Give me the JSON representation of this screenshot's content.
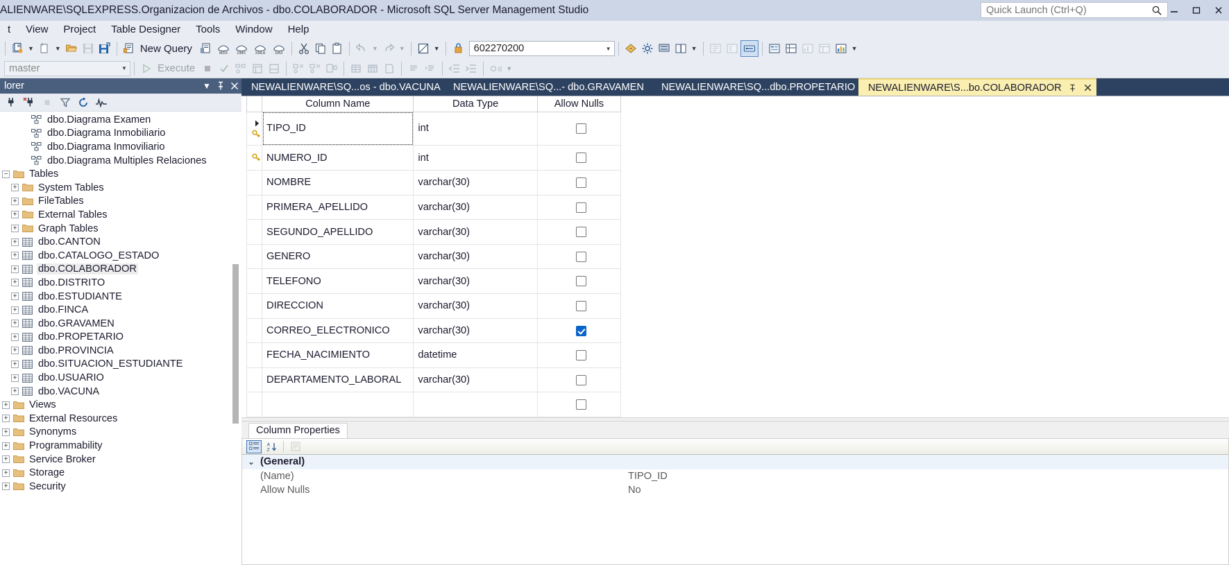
{
  "titlebar": {
    "title": "ALIENWARE\\SQLEXPRESS.Organizacion de Archivos - dbo.COLABORADOR - Microsoft SQL Server Management Studio",
    "quick_launch_placeholder": "Quick Launch (Ctrl+Q)",
    "quick_launch_value": "",
    "search_icon": "search-icon",
    "minimize_label": "—",
    "restore_label": "❐",
    "close_label": "✕"
  },
  "menubar": {
    "items": [
      {
        "label": "t"
      },
      {
        "label": "View"
      },
      {
        "label": "Project"
      },
      {
        "label": "Table Designer"
      },
      {
        "label": "Tools"
      },
      {
        "label": "Window"
      },
      {
        "label": "Help"
      }
    ]
  },
  "toolbar": {
    "new_query_label": "New Query",
    "object_value": "602270200",
    "database_value": "master",
    "execute_label": "Execute",
    "buttons": [
      "new-project-icon",
      "new-item-icon",
      "open-file-icon",
      "save-icon",
      "save-all-icon",
      "new-query-icon",
      "new-query-with-current-connection-icon",
      "new-analysis-services-mdx-query-icon",
      "new-analysis-services-dmx-query-icon",
      "new-analysis-services-xmla-query-icon",
      "new-dax-query-icon",
      "cut-icon",
      "copy-icon",
      "paste-icon",
      "undo-icon",
      "redo-icon",
      "toggle-window-icon",
      "object-explorer-details-icon",
      "properties-window-icon",
      "registered-servers-icon",
      "template-explorer-icon",
      "solution-explorer-icon",
      "bookmark-window-icon",
      "error-list-icon",
      "utility-explorer-icon",
      "object-explorer-icon"
    ],
    "query_buttons": [
      "execute-icon",
      "stop-icon",
      "parse-icon",
      "display-estimated-plan-icon",
      "query-options-icon",
      "include-actual-plan-icon",
      "include-client-statistics-icon",
      "results-to-text-icon",
      "results-to-grid-icon",
      "results-to-file-icon",
      "comment-icon",
      "uncomment-icon",
      "decrease-indent-icon",
      "increase-indent-icon",
      "specify-values-for-template-parameters-icon"
    ]
  },
  "explorer": {
    "title": "lorer",
    "header_buttons": [
      "dropdown-icon",
      "pin-icon",
      "close-icon"
    ],
    "toolbar_buttons": [
      "connect-icon",
      "disconnect-icon",
      "stop-icon",
      "filter-icon",
      "refresh-icon",
      "activity-monitor-icon"
    ],
    "tree": [
      {
        "label": "dbo.Diagrama Examen",
        "indent": 3,
        "expander": "none",
        "icon": "diagram-icon"
      },
      {
        "label": "dbo.Diagrama Inmobiliario",
        "indent": 3,
        "expander": "none",
        "icon": "diagram-icon"
      },
      {
        "label": "dbo.Diagrama Inmoviliario",
        "indent": 3,
        "expander": "none",
        "icon": "diagram-icon"
      },
      {
        "label": "dbo.Diagrama Multiples Relaciones",
        "indent": 3,
        "expander": "none",
        "icon": "diagram-icon"
      },
      {
        "label": "Tables",
        "indent": 1,
        "expander": "minus",
        "icon": "folder-icon"
      },
      {
        "label": "System Tables",
        "indent": 2,
        "expander": "plus",
        "icon": "folder-icon"
      },
      {
        "label": "FileTables",
        "indent": 2,
        "expander": "plus",
        "icon": "folder-icon"
      },
      {
        "label": "External Tables",
        "indent": 2,
        "expander": "plus",
        "icon": "folder-icon"
      },
      {
        "label": "Graph Tables",
        "indent": 2,
        "expander": "plus",
        "icon": "folder-icon"
      },
      {
        "label": "dbo.CANTON",
        "indent": 2,
        "expander": "plus",
        "icon": "table-icon"
      },
      {
        "label": "dbo.CATALOGO_ESTADO",
        "indent": 2,
        "expander": "plus",
        "icon": "table-icon"
      },
      {
        "label": "dbo.COLABORADOR",
        "indent": 2,
        "expander": "plus",
        "icon": "table-icon",
        "selected": true
      },
      {
        "label": "dbo.DISTRITO",
        "indent": 2,
        "expander": "plus",
        "icon": "table-icon"
      },
      {
        "label": "dbo.ESTUDIANTE",
        "indent": 2,
        "expander": "plus",
        "icon": "table-icon"
      },
      {
        "label": "dbo.FINCA",
        "indent": 2,
        "expander": "plus",
        "icon": "table-icon"
      },
      {
        "label": "dbo.GRAVAMEN",
        "indent": 2,
        "expander": "plus",
        "icon": "table-icon"
      },
      {
        "label": "dbo.PROPETARIO",
        "indent": 2,
        "expander": "plus",
        "icon": "table-icon"
      },
      {
        "label": "dbo.PROVINCIA",
        "indent": 2,
        "expander": "plus",
        "icon": "table-icon"
      },
      {
        "label": "dbo.SITUACION_ESTUDIANTE",
        "indent": 2,
        "expander": "plus",
        "icon": "table-icon"
      },
      {
        "label": "dbo.USUARIO",
        "indent": 2,
        "expander": "plus",
        "icon": "table-icon"
      },
      {
        "label": "dbo.VACUNA",
        "indent": 2,
        "expander": "plus",
        "icon": "table-icon"
      },
      {
        "label": "Views",
        "indent": 1,
        "expander": "plus",
        "icon": "folder-icon"
      },
      {
        "label": "External Resources",
        "indent": 1,
        "expander": "plus",
        "icon": "folder-icon"
      },
      {
        "label": "Synonyms",
        "indent": 1,
        "expander": "plus",
        "icon": "folder-icon"
      },
      {
        "label": "Programmability",
        "indent": 1,
        "expander": "plus",
        "icon": "folder-icon"
      },
      {
        "label": "Service Broker",
        "indent": 1,
        "expander": "plus",
        "icon": "folder-icon"
      },
      {
        "label": "Storage",
        "indent": 1,
        "expander": "plus",
        "icon": "folder-icon"
      },
      {
        "label": "Security",
        "indent": 1,
        "expander": "plus",
        "icon": "folder-icon"
      }
    ]
  },
  "tabs": [
    {
      "label": "NEWALIENWARE\\SQ...os - dbo.VACUNA",
      "active": false
    },
    {
      "label": "NEWALIENWARE\\SQ...- dbo.GRAVAMEN",
      "active": false
    },
    {
      "label": "NEWALIENWARE\\SQ...dbo.PROPETARIO",
      "active": false
    },
    {
      "label": "NEWALIENWARE\\S...bo.COLABORADOR",
      "active": true,
      "pin": "⚐",
      "close": "✕"
    }
  ],
  "designer": {
    "headers": [
      "Column Name",
      "Data Type",
      "Allow Nulls"
    ],
    "rows": [
      {
        "name": "TIPO_ID",
        "type": "int",
        "allow_nulls": false,
        "key": "primary-key-icon",
        "current": true,
        "selected": true
      },
      {
        "name": "NUMERO_ID",
        "type": "int",
        "allow_nulls": false,
        "key": "primary-key-icon"
      },
      {
        "name": "NOMBRE",
        "type": "varchar(30)",
        "allow_nulls": false
      },
      {
        "name": "PRIMERA_APELLIDO",
        "type": "varchar(30)",
        "allow_nulls": false
      },
      {
        "name": "SEGUNDO_APELLIDO",
        "type": "varchar(30)",
        "allow_nulls": false
      },
      {
        "name": "GENERO",
        "type": "varchar(30)",
        "allow_nulls": false
      },
      {
        "name": "TELEFONO",
        "type": "varchar(30)",
        "allow_nulls": false
      },
      {
        "name": "DIRECCION",
        "type": "varchar(30)",
        "allow_nulls": false
      },
      {
        "name": "CORREO_ELECTRONICO",
        "type": "varchar(30)",
        "allow_nulls": true
      },
      {
        "name": "FECHA_NACIMIENTO",
        "type": "datetime",
        "allow_nulls": false
      },
      {
        "name": "DEPARTAMENTO_LABORAL",
        "type": "varchar(30)",
        "allow_nulls": false
      },
      {
        "name": "",
        "type": "",
        "allow_nulls": false,
        "blank": true
      }
    ]
  },
  "properties": {
    "tab_label": "Column Properties",
    "toolbar_buttons": [
      "categorized-icon",
      "alphabetical-icon",
      "property-pages-icon"
    ],
    "group_chevron": "⌄",
    "rows": [
      {
        "name": "(General)",
        "value": "",
        "group": true
      },
      {
        "name": "(Name)",
        "value": "TIPO_ID"
      },
      {
        "name": "Allow Nulls",
        "value": "No"
      }
    ]
  }
}
